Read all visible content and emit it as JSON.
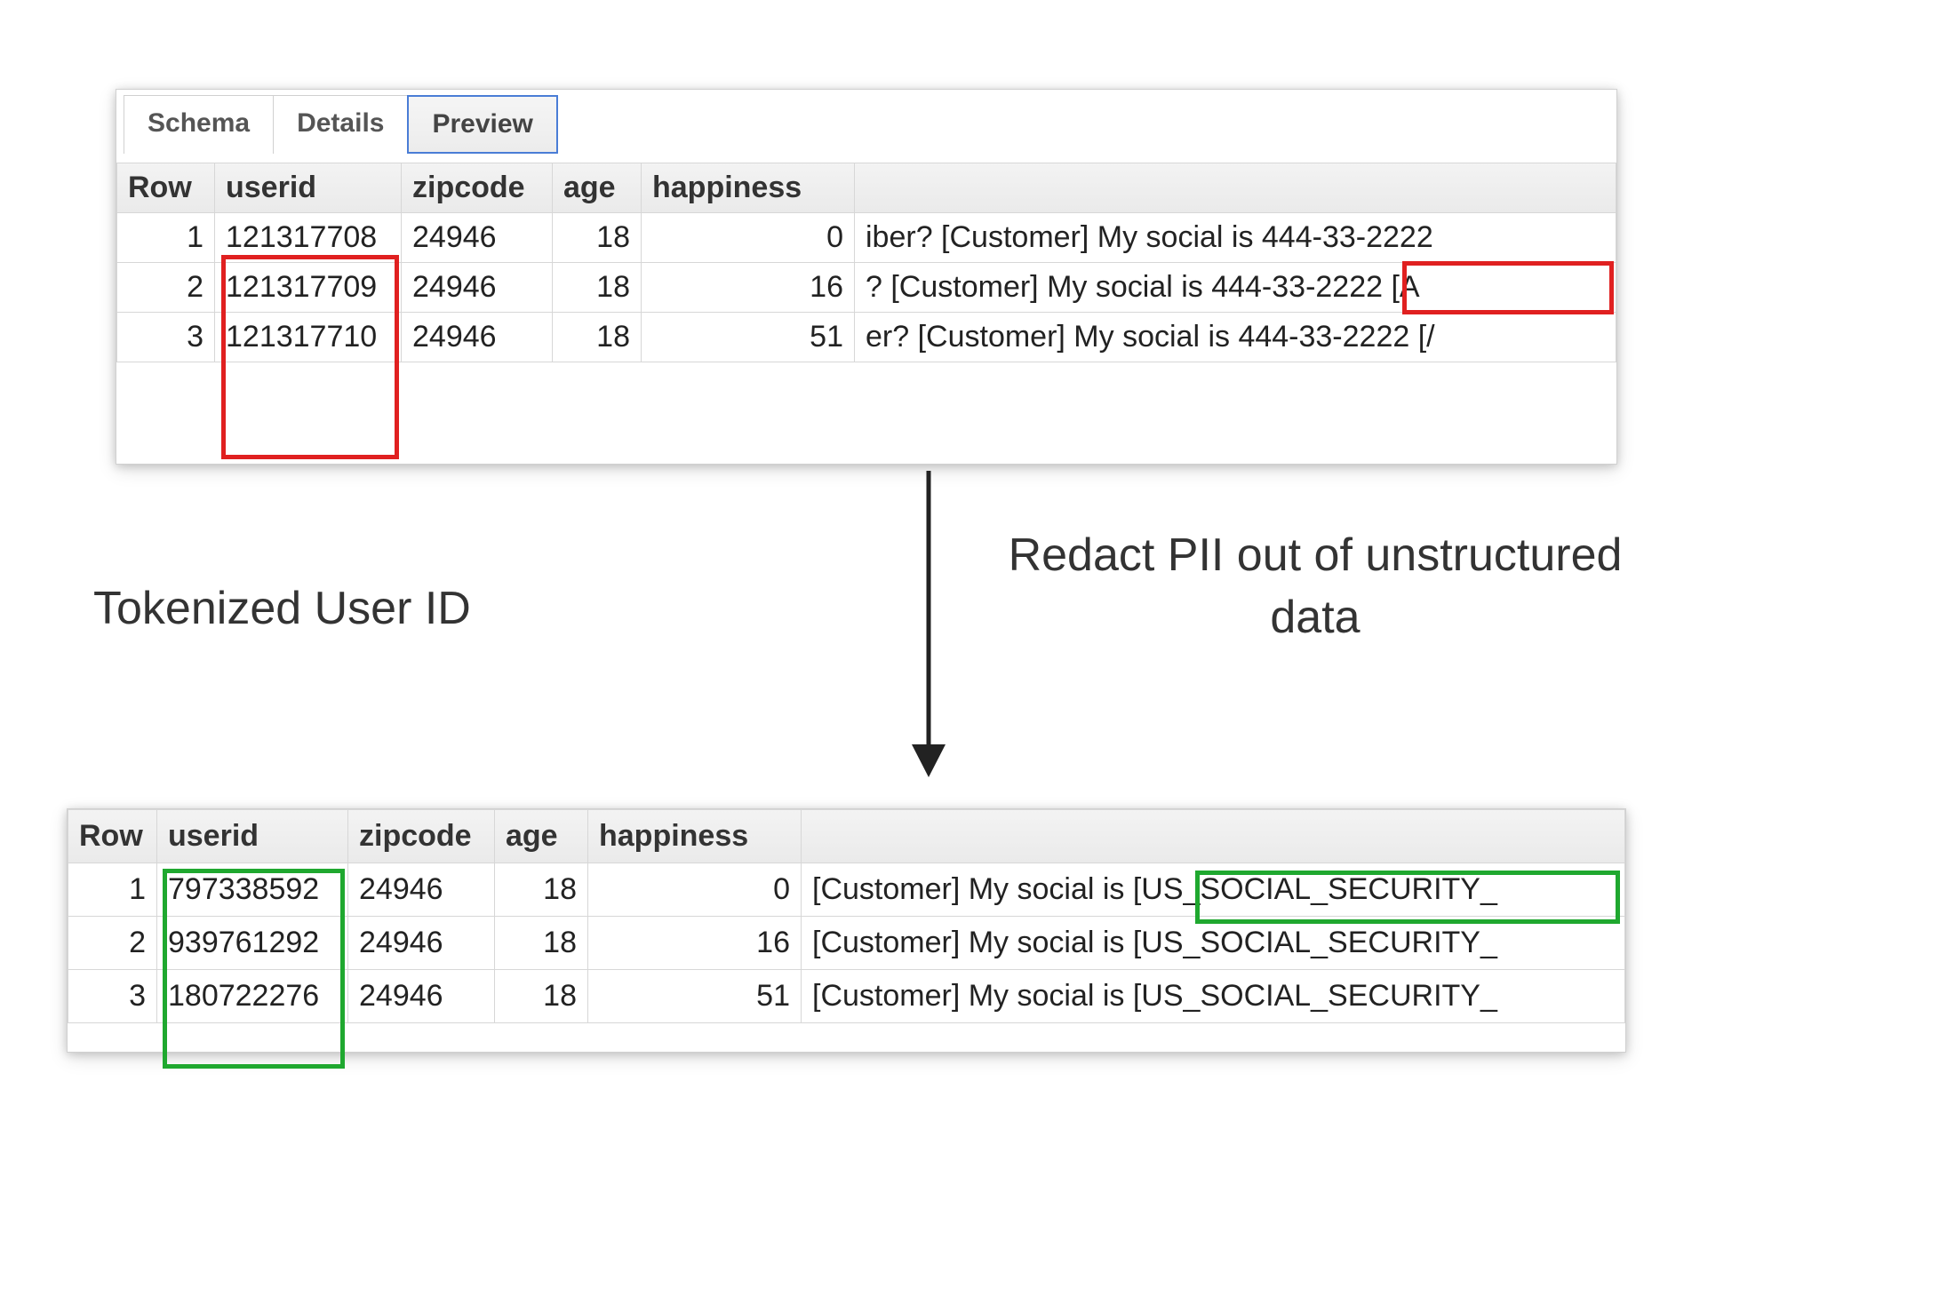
{
  "tabs": [
    "Schema",
    "Details",
    "Preview"
  ],
  "activeTab": 2,
  "topTable": {
    "headers": [
      "Row",
      "userid",
      "zipcode",
      "age",
      "happiness",
      ""
    ],
    "rows": [
      {
        "row": "1",
        "userid": "121317708",
        "zipcode": "24946",
        "age": "18",
        "happiness": "0",
        "text": "iber? [Customer] My social is 444-33-2222"
      },
      {
        "row": "2",
        "userid": "121317709",
        "zipcode": "24946",
        "age": "18",
        "happiness": "16",
        "text": "? [Customer] My social is 444-33-2222 [A"
      },
      {
        "row": "3",
        "userid": "121317710",
        "zipcode": "24946",
        "age": "18",
        "happiness": "51",
        "text": "er? [Customer] My social is 444-33-2222 [/"
      }
    ]
  },
  "bottomTable": {
    "headers": [
      "Row",
      "userid",
      "zipcode",
      "age",
      "happiness",
      ""
    ],
    "rows": [
      {
        "row": "1",
        "userid": "797338592",
        "zipcode": "24946",
        "age": "18",
        "happiness": "0",
        "text": "[Customer] My social is [US_SOCIAL_SECURITY_"
      },
      {
        "row": "2",
        "userid": "939761292",
        "zipcode": "24946",
        "age": "18",
        "happiness": "16",
        "text": "[Customer] My social is [US_SOCIAL_SECURITY_"
      },
      {
        "row": "3",
        "userid": "180722276",
        "zipcode": "24946",
        "age": "18",
        "happiness": "51",
        "text": "[Customer] My social is [US_SOCIAL_SECURITY_"
      }
    ]
  },
  "labels": {
    "left": "Tokenized User ID",
    "right": "Redact PII out of unstructured data"
  },
  "highlights": {
    "top_userid_box": {
      "color": "red"
    },
    "top_ssn_box": {
      "color": "red"
    },
    "bottom_userid_box": {
      "color": "green"
    },
    "bottom_ssn_box": {
      "color": "green"
    }
  }
}
